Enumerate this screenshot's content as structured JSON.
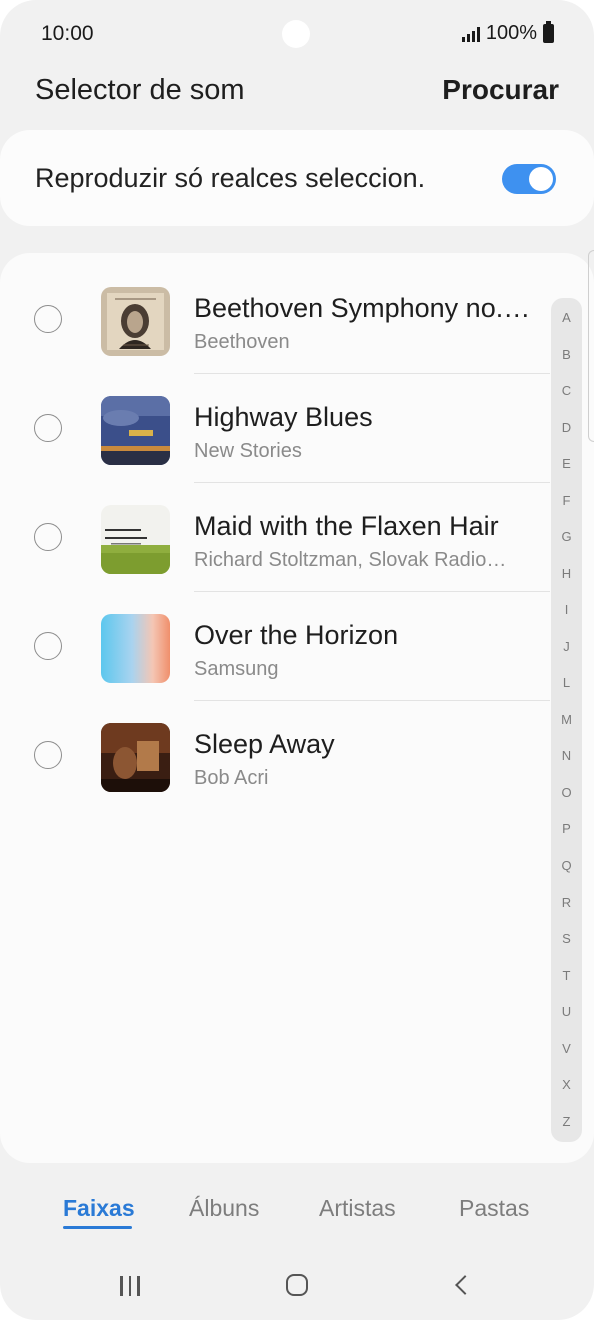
{
  "status": {
    "time": "10:00",
    "battery": "100%"
  },
  "header": {
    "title": "Selector de som",
    "search_label": "Procurar"
  },
  "highlights": {
    "label": "Reproduzir só realces seleccion.",
    "enabled": true
  },
  "tracks": [
    {
      "title": "Beethoven Symphony no.…",
      "artist": "Beethoven",
      "selected": false
    },
    {
      "title": "Highway Blues",
      "artist": "New Stories",
      "selected": false
    },
    {
      "title": "Maid with the Flaxen Hair",
      "artist": "Richard Stoltzman, Slovak Radio…",
      "selected": false
    },
    {
      "title": "Over the Horizon",
      "artist": "Samsung",
      "selected": false
    },
    {
      "title": "Sleep Away",
      "artist": "Bob Acri",
      "selected": false
    }
  ],
  "index_letters": [
    "A",
    "B",
    "C",
    "D",
    "E",
    "F",
    "G",
    "H",
    "I",
    "J",
    "L",
    "M",
    "N",
    "O",
    "P",
    "Q",
    "R",
    "S",
    "T",
    "U",
    "V",
    "X",
    "Z"
  ],
  "tabs": [
    {
      "label": "Faixas",
      "active": true
    },
    {
      "label": "Álbuns",
      "active": false
    },
    {
      "label": "Artistas",
      "active": false
    },
    {
      "label": "Pastas",
      "active": false
    }
  ],
  "colors": {
    "accent": "#2a7ad6",
    "toggle": "#3e91f0"
  },
  "icons": {
    "nav": [
      "recent-apps-icon",
      "home-icon",
      "back-icon"
    ]
  }
}
